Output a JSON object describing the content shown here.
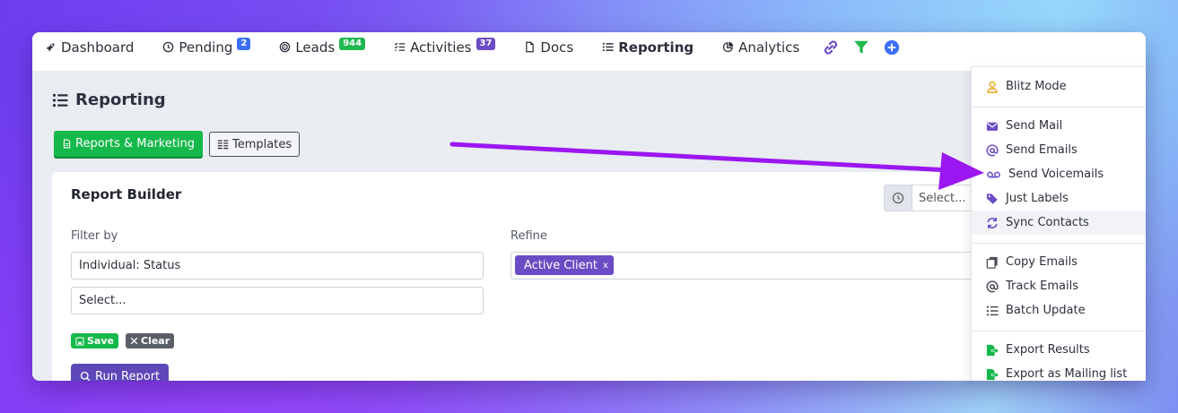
{
  "nav": {
    "items": [
      {
        "label": "Dashboard",
        "icon": "rocket-icon"
      },
      {
        "label": "Pending",
        "icon": "clock-icon",
        "badge": "2",
        "badge_color": "#3b6ff5"
      },
      {
        "label": "Leads",
        "icon": "target-icon",
        "badge": "944",
        "badge_color": "#1fb94f"
      },
      {
        "label": "Activities",
        "icon": "checklist-icon",
        "badge": "37",
        "badge_color": "#6b4cc4"
      },
      {
        "label": "Docs",
        "icon": "file-icon"
      },
      {
        "label": "Reporting",
        "icon": "list-icon",
        "active": true
      },
      {
        "label": "Analytics",
        "icon": "pie-chart-icon"
      }
    ],
    "icon_buttons": [
      "link-icon",
      "filter-icon",
      "plus-circle-icon"
    ]
  },
  "page": {
    "title": "Reporting",
    "tabs": {
      "reports_label": "Reports & Marketing",
      "templates_label": "Templates"
    }
  },
  "builder": {
    "title": "Report Builder",
    "time_select_placeholder": "Select...",
    "filter_label": "Filter by",
    "filter_value": "Individual: Status",
    "filter_second_placeholder": "Select...",
    "refine_label": "Refine",
    "refine_tag": "Active Client",
    "refine_tag_remove": "x",
    "save_label": "Save",
    "clear_label": "Clear",
    "run_label": "Run Report"
  },
  "menu": {
    "items": [
      {
        "label": "Blitz Mode",
        "icon": "user-icon"
      },
      {
        "label": "Send Mail",
        "icon": "envelope-icon"
      },
      {
        "label": "Send Emails",
        "icon": "at-icon"
      },
      {
        "label": "Send Voicemails",
        "icon": "voicemail-icon"
      },
      {
        "label": "Just Labels",
        "icon": "tags-icon"
      },
      {
        "label": "Sync Contacts",
        "icon": "sync-icon"
      },
      {
        "label": "Copy Emails",
        "icon": "copy-icon"
      },
      {
        "label": "Track Emails",
        "icon": "at-icon"
      },
      {
        "label": "Batch Update",
        "icon": "list-icon"
      },
      {
        "label": "Export Results",
        "icon": "file-export-icon"
      },
      {
        "label": "Export as Mailing list",
        "icon": "file-export-icon"
      }
    ]
  },
  "colors": {
    "accent_purple": "#6b4cc4",
    "green": "#15b84a",
    "arrow": "#9b17f2"
  }
}
